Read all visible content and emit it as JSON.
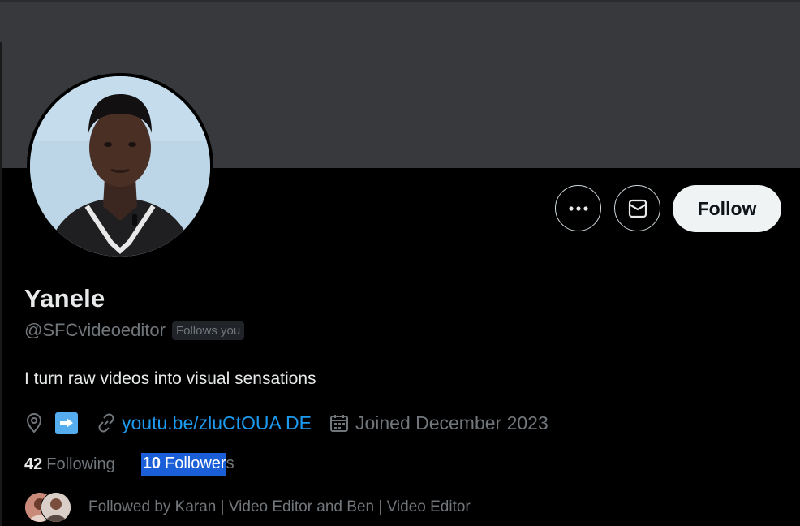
{
  "profile": {
    "display_name": "Yanele",
    "handle": "@SFCvideoeditor",
    "follows_you_badge": "Follows you",
    "bio": "I turn raw videos into visual sensations",
    "location_emoji": "➡",
    "website": "youtu.be/zluCtOUA DE",
    "joined": "Joined December 2023"
  },
  "actions": {
    "more_icon": "more-horizontal-icon",
    "message_icon": "envelope-icon",
    "follow_label": "Follow"
  },
  "stats": {
    "following_count": "42",
    "following_label": "Following",
    "followers_count": "10",
    "followers_label_selected": "Follower",
    "followers_label_tail": "s"
  },
  "followed_by": {
    "text": "Followed by Karan | Video Editor and Ben | Video Editor"
  },
  "colors": {
    "banner": "#38393c",
    "background": "#000000",
    "link": "#1d9bf0",
    "muted": "#71767b",
    "selection": "#1a5fd8"
  }
}
